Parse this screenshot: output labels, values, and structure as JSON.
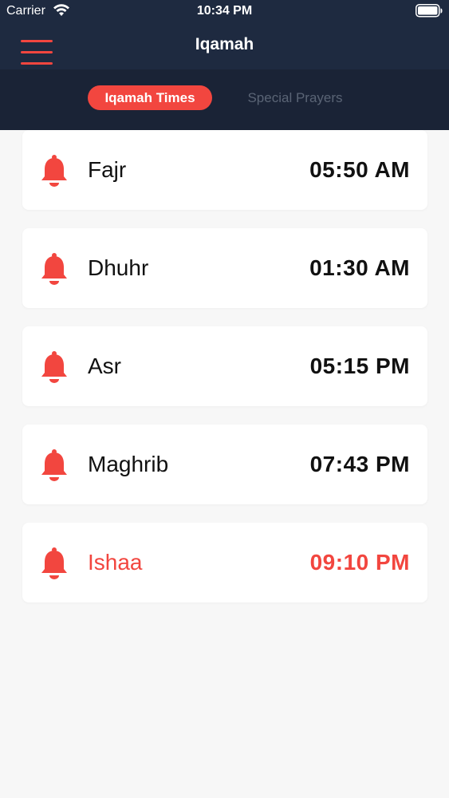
{
  "status_bar": {
    "carrier": "Carrier",
    "time": "10:34 PM",
    "icons": [
      "wifi-icon",
      "battery-icon"
    ]
  },
  "nav": {
    "title": "Iqamah",
    "menu_icon": "hamburger-menu-icon"
  },
  "tabs": [
    {
      "label": "Iqamah Times",
      "active": true
    },
    {
      "label": "Special Prayers",
      "active": false
    }
  ],
  "prayers": [
    {
      "name": "Fajr",
      "time": "05:50 AM",
      "highlighted": false,
      "icon": "bell-icon"
    },
    {
      "name": "Dhuhr",
      "time": "01:30 AM",
      "highlighted": false,
      "icon": "bell-icon"
    },
    {
      "name": "Asr",
      "time": "05:15 PM",
      "highlighted": false,
      "icon": "bell-icon"
    },
    {
      "name": "Maghrib",
      "time": "07:43 PM",
      "highlighted": false,
      "icon": "bell-icon"
    },
    {
      "name": "Ishaa",
      "time": "09:10 PM",
      "highlighted": true,
      "icon": "bell-icon"
    }
  ],
  "colors": {
    "accent": "#f2463f",
    "header_bg": "#1e2a40",
    "segment_bg": "#1a2336",
    "page_bg": "#f7f7f7",
    "inactive_tab": "#5a6475"
  }
}
